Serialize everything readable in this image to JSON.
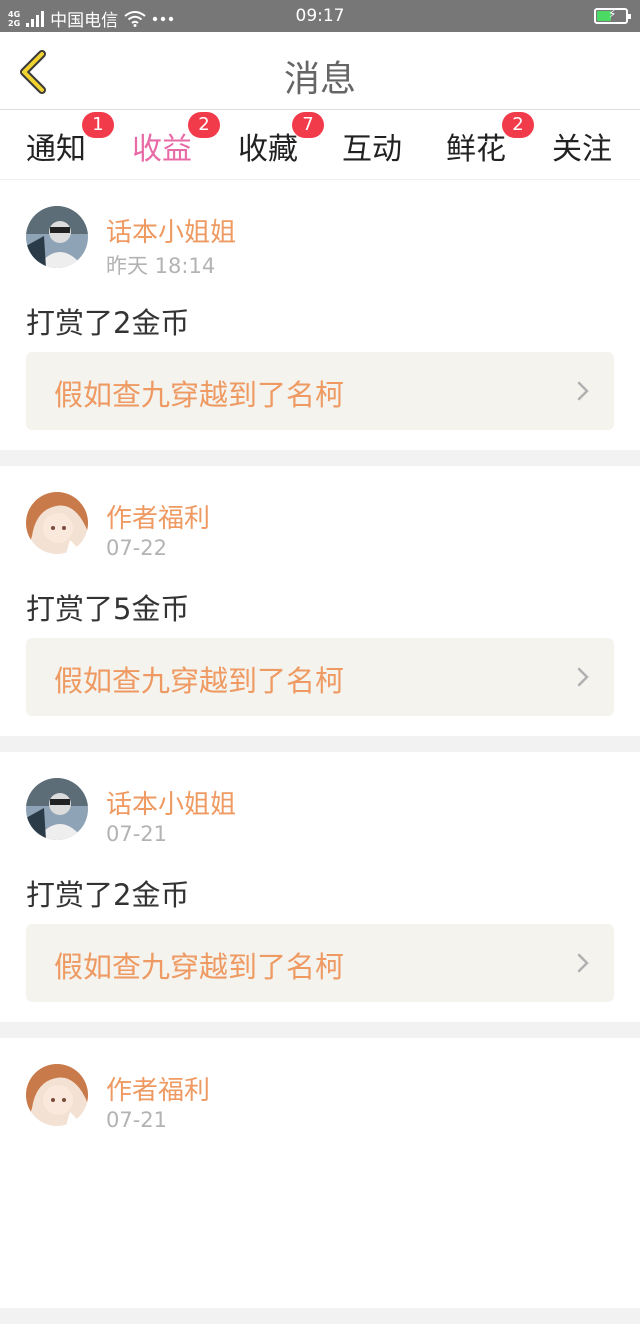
{
  "status": {
    "network_top": "4G",
    "network_bottom": "2G",
    "carrier": "中国电信",
    "time": "09:17",
    "battery_level": 0.45
  },
  "header": {
    "title": "消息"
  },
  "tabs": [
    {
      "label": "通知",
      "badge": "1"
    },
    {
      "label": "收益",
      "badge": "2",
      "active": true
    },
    {
      "label": "收藏",
      "badge": "7"
    },
    {
      "label": "互动",
      "badge": ""
    },
    {
      "label": "鲜花",
      "badge": "2"
    },
    {
      "label": "关注",
      "badge": ""
    }
  ],
  "feed": [
    {
      "author": "话本小姐姐",
      "time": "昨天 18:14",
      "desc": "打赏了2金币",
      "book": "假如查九穿越到了名柯",
      "avatar": "avatar-grey"
    },
    {
      "author": "作者福利",
      "time": "07-22",
      "desc": "打赏了5金币",
      "book": "假如查九穿越到了名柯",
      "avatar": "avatar-anime"
    },
    {
      "author": "话本小姐姐",
      "time": "07-21",
      "desc": "打赏了2金币",
      "book": "假如查九穿越到了名柯",
      "avatar": "avatar-grey"
    },
    {
      "author": "作者福利",
      "time": "07-21",
      "desc": "",
      "book": "",
      "avatar": "avatar-anime"
    }
  ],
  "colors": {
    "accent": "#e86aa6",
    "author": "#ee9a62",
    "badge": "#f23b4a"
  }
}
